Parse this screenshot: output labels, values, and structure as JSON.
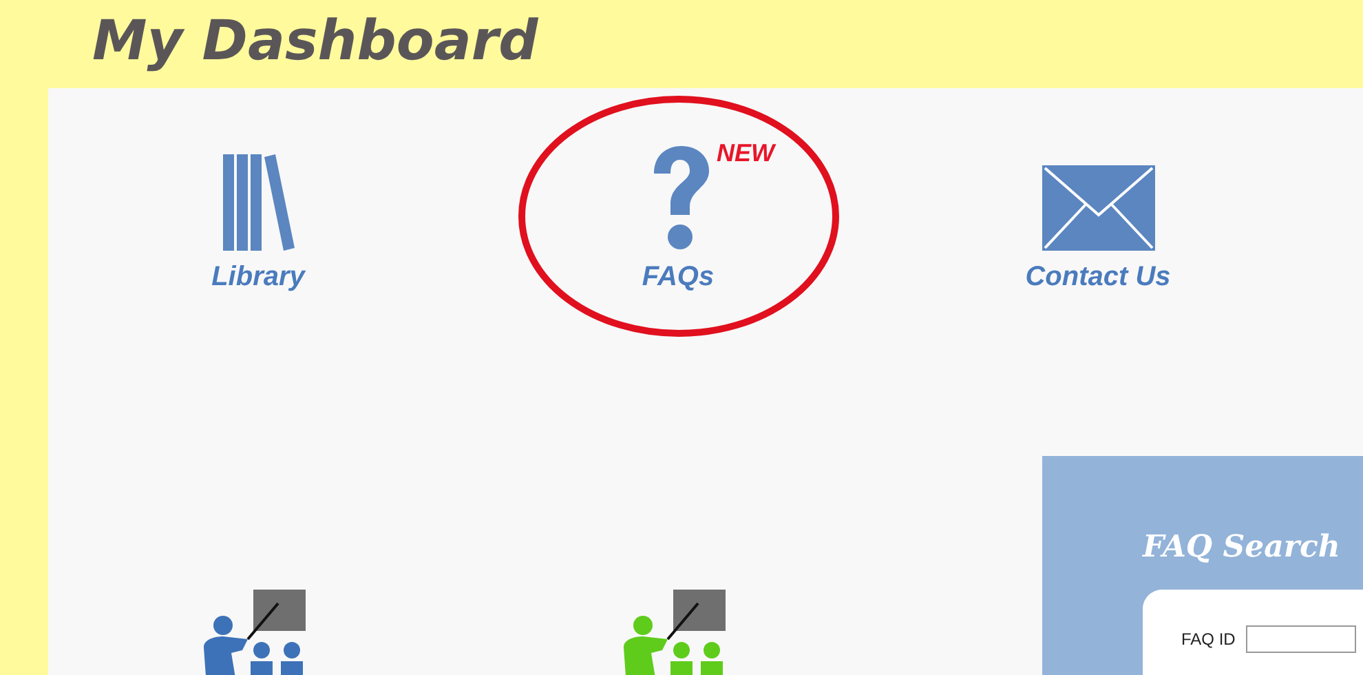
{
  "title": "My Dashboard",
  "tiles": [
    {
      "kind": "books",
      "label": "Library",
      "highlighted": false
    },
    {
      "kind": "question",
      "label": "FAQs",
      "badge": "NEW",
      "highlighted": true
    },
    {
      "kind": "envelope",
      "label": "Contact Us",
      "highlighted": false
    }
  ],
  "lower_tiles": [
    {
      "color": "#3d72b8"
    },
    {
      "color": "#5fcc1c"
    }
  ],
  "faq_search": {
    "title": "FAQ Search",
    "fields": [
      {
        "label": "FAQ ID"
      }
    ]
  }
}
